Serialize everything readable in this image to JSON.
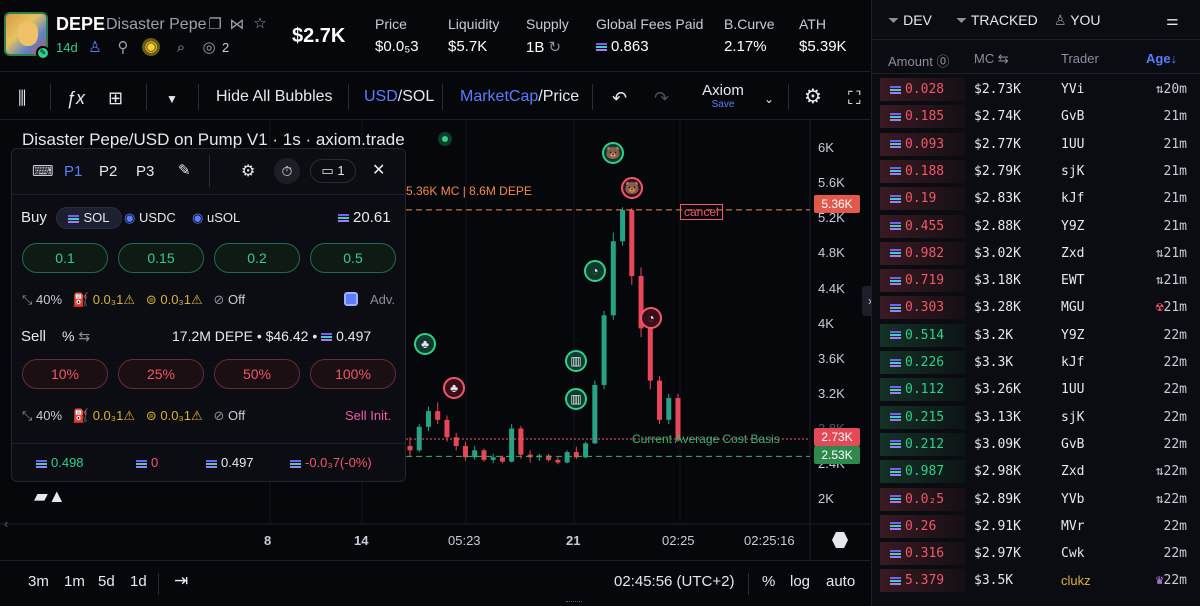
{
  "header": {
    "ticker": "DEPE",
    "name": "Disaster Pepe",
    "age": "14d",
    "watchers": "2",
    "market_cap": "$2.7K",
    "stats": [
      {
        "label": "Price",
        "value": "$0.0₅3"
      },
      {
        "label": "Liquidity",
        "value": "$5.7K"
      },
      {
        "label": "Supply",
        "value": "1B"
      },
      {
        "label": "Global Fees Paid",
        "value": "0.863"
      },
      {
        "label": "B.Curve",
        "value": "2.17%"
      },
      {
        "label": "ATH",
        "value": "$5.39K"
      }
    ]
  },
  "toolbar": {
    "hide_bubbles": "Hide All Bubbles",
    "currency_usd": "USD",
    "currency_sep": "/",
    "currency_sol": "SOL",
    "mode_mc": "MarketCap",
    "mode_sep": "/",
    "mode_price": "Price",
    "layout_name": "Axiom",
    "layout_sub": "Save"
  },
  "chart": {
    "title": "Disaster Pepe/USD on Pump V1 · 1s · axiom.trade",
    "ath_label": "5.36K MC | 8.6M DEPE",
    "cancel": "cancel",
    "avg_cost": "Current Average Cost Basis",
    "y_ticks": [
      "6K",
      "5.6K",
      "5.2K",
      "4.8K",
      "4.4K",
      "4K",
      "3.6K",
      "3.2K",
      "2.8K",
      "2.4K",
      "2K"
    ],
    "x_ticks": [
      "8",
      "14",
      "05:23",
      "21",
      "02:25",
      "02:25:16"
    ],
    "tag_ath": "5.36K",
    "tag_now": "2.73K",
    "tag_avg": "2.53K"
  },
  "chart_data": {
    "type": "candlestick",
    "title": "Disaster Pepe/USD on Pump V1 · 1s · axiom.trade",
    "ylim": [
      1800,
      6300
    ],
    "price_lines": [
      {
        "label": "5.36K MC | 8.6M DEPE",
        "value": 5360,
        "color": "#f08a4b"
      },
      {
        "label": "Current Average Cost Basis",
        "value": 2530,
        "color": "#3bb36a"
      },
      {
        "label": "current",
        "value": 2730,
        "color": "#f0586b"
      }
    ],
    "candles": [
      {
        "o": 2650,
        "h": 2750,
        "l": 2520,
        "c": 2600
      },
      {
        "o": 2600,
        "h": 2900,
        "l": 2580,
        "c": 2870
      },
      {
        "o": 2870,
        "h": 3100,
        "l": 2820,
        "c": 3050
      },
      {
        "o": 3050,
        "h": 3150,
        "l": 2900,
        "c": 2950
      },
      {
        "o": 2950,
        "h": 3000,
        "l": 2700,
        "c": 2750
      },
      {
        "o": 2750,
        "h": 2800,
        "l": 2600,
        "c": 2650
      },
      {
        "o": 2650,
        "h": 2700,
        "l": 2480,
        "c": 2520
      },
      {
        "o": 2520,
        "h": 2650,
        "l": 2490,
        "c": 2600
      },
      {
        "o": 2600,
        "h": 2620,
        "l": 2470,
        "c": 2490
      },
      {
        "o": 2490,
        "h": 2560,
        "l": 2450,
        "c": 2520
      },
      {
        "o": 2520,
        "h": 2540,
        "l": 2450,
        "c": 2470
      },
      {
        "o": 2470,
        "h": 2900,
        "l": 2460,
        "c": 2850
      },
      {
        "o": 2850,
        "h": 2880,
        "l": 2500,
        "c": 2550
      },
      {
        "o": 2550,
        "h": 2600,
        "l": 2460,
        "c": 2520
      },
      {
        "o": 2520,
        "h": 2560,
        "l": 2480,
        "c": 2540
      },
      {
        "o": 2540,
        "h": 2560,
        "l": 2470,
        "c": 2490
      },
      {
        "o": 2490,
        "h": 2520,
        "l": 2440,
        "c": 2460
      },
      {
        "o": 2460,
        "h": 2600,
        "l": 2450,
        "c": 2580
      },
      {
        "o": 2580,
        "h": 2640,
        "l": 2500,
        "c": 2520
      },
      {
        "o": 2520,
        "h": 2700,
        "l": 2510,
        "c": 2680
      },
      {
        "o": 2680,
        "h": 3400,
        "l": 2670,
        "c": 3350
      },
      {
        "o": 3350,
        "h": 4200,
        "l": 3300,
        "c": 4150
      },
      {
        "o": 4150,
        "h": 5100,
        "l": 4100,
        "c": 5000
      },
      {
        "o": 5000,
        "h": 5390,
        "l": 4950,
        "c": 5360
      },
      {
        "o": 5360,
        "h": 5380,
        "l": 4500,
        "c": 4600
      },
      {
        "o": 4600,
        "h": 4700,
        "l": 3900,
        "c": 4000
      },
      {
        "o": 4000,
        "h": 4050,
        "l": 3300,
        "c": 3400
      },
      {
        "o": 3400,
        "h": 3450,
        "l": 2900,
        "c": 2950
      },
      {
        "o": 2950,
        "h": 3250,
        "l": 2900,
        "c": 3200
      },
      {
        "o": 3200,
        "h": 3250,
        "l": 2700,
        "c": 2730
      }
    ]
  },
  "trade_panel": {
    "presets": [
      "P1",
      "P2",
      "P3"
    ],
    "timer_count": "1",
    "buy_label": "Buy",
    "buy_currencies": [
      "SOL",
      "USDC",
      "uSOL"
    ],
    "balance": "20.61",
    "buy_amounts": [
      "0.1",
      "0.15",
      "0.2",
      "0.5"
    ],
    "buy_settings": {
      "slippage": "40%",
      "priority": "0.0₃1",
      "bribe": "0.0₃1",
      "mev": "Off",
      "adv": "Adv."
    },
    "sell_label": "Sell",
    "sell_unit": "%",
    "position": "17.2M DEPE • $46.42 •",
    "position_sol": "0.497",
    "sell_amounts": [
      "10%",
      "25%",
      "50%",
      "100%"
    ],
    "sell_settings": {
      "slippage": "40%",
      "priority": "0.0₃1",
      "bribe": "0.0₃1",
      "mev": "Off",
      "init": "Sell Init."
    },
    "pnl": {
      "bought": "0.498",
      "sold": "0",
      "holding": "0.497",
      "pnl": "-0.0₃7(-0%)"
    }
  },
  "bottom": {
    "ranges": [
      "3m",
      "1m",
      "5d",
      "1d"
    ],
    "time": "02:45:56 (UTC+2)",
    "percent": "%",
    "log": "log",
    "auto": "auto"
  },
  "trades_panel": {
    "tabs": [
      "DEV",
      "TRACKED",
      "YOU"
    ],
    "columns": {
      "amount": "Amount",
      "mc": "MC",
      "trader": "Trader",
      "age": "Age"
    },
    "rows": [
      {
        "side": "sell",
        "amount": "0.028",
        "mc": "$2.73K",
        "trader": "YVi",
        "age": "20m",
        "icon": "⇅"
      },
      {
        "side": "sell",
        "amount": "0.185",
        "mc": "$2.74K",
        "trader": "GvB",
        "age": "21m",
        "icon": ""
      },
      {
        "side": "sell",
        "amount": "0.093",
        "mc": "$2.77K",
        "trader": "1UU",
        "age": "21m",
        "icon": ""
      },
      {
        "side": "sell",
        "amount": "0.188",
        "mc": "$2.79K",
        "trader": "sjK",
        "age": "21m",
        "icon": ""
      },
      {
        "side": "sell",
        "amount": "0.19",
        "mc": "$2.83K",
        "trader": "kJf",
        "age": "21m",
        "icon": ""
      },
      {
        "side": "sell",
        "amount": "0.455",
        "mc": "$2.88K",
        "trader": "Y9Z",
        "age": "21m",
        "icon": ""
      },
      {
        "side": "sell",
        "amount": "0.982",
        "mc": "$3.02K",
        "trader": "Zxd",
        "age": "21m",
        "icon": "⇅"
      },
      {
        "side": "sell",
        "amount": "0.719",
        "mc": "$3.18K",
        "trader": "EWT",
        "age": "21m",
        "icon": "⇅"
      },
      {
        "side": "sell",
        "amount": "0.303",
        "mc": "$3.28K",
        "trader": "MGU",
        "age": "21m",
        "icon": "☢"
      },
      {
        "side": "buy",
        "amount": "0.514",
        "mc": "$3.2K",
        "trader": "Y9Z",
        "age": "22m",
        "icon": ""
      },
      {
        "side": "buy",
        "amount": "0.226",
        "mc": "$3.3K",
        "trader": "kJf",
        "age": "22m",
        "icon": ""
      },
      {
        "side": "buy",
        "amount": "0.112",
        "mc": "$3.26K",
        "trader": "1UU",
        "age": "22m",
        "icon": ""
      },
      {
        "side": "buy",
        "amount": "0.215",
        "mc": "$3.13K",
        "trader": "sjK",
        "age": "22m",
        "icon": ""
      },
      {
        "side": "buy",
        "amount": "0.212",
        "mc": "$3.09K",
        "trader": "GvB",
        "age": "22m",
        "icon": ""
      },
      {
        "side": "buy",
        "amount": "0.987",
        "mc": "$2.98K",
        "trader": "Zxd",
        "age": "22m",
        "icon": "⇅"
      },
      {
        "side": "sell",
        "amount": "0.0₂5",
        "mc": "$2.89K",
        "trader": "YVb",
        "age": "22m",
        "icon": "⇅"
      },
      {
        "side": "sell",
        "amount": "0.26",
        "mc": "$2.91K",
        "trader": "MVr",
        "age": "22m",
        "icon": ""
      },
      {
        "side": "sell",
        "amount": "0.316",
        "mc": "$2.97K",
        "trader": "Cwk",
        "age": "22m",
        "icon": ""
      },
      {
        "side": "sell",
        "amount": "5.379",
        "mc": "$3.5K",
        "trader": "clukz",
        "age": "22m",
        "icon": "♛"
      }
    ]
  },
  "colors": {
    "green": "#2fd08a",
    "red": "#f0586b",
    "accent": "#5b7cff",
    "orange": "#f08a4b"
  }
}
